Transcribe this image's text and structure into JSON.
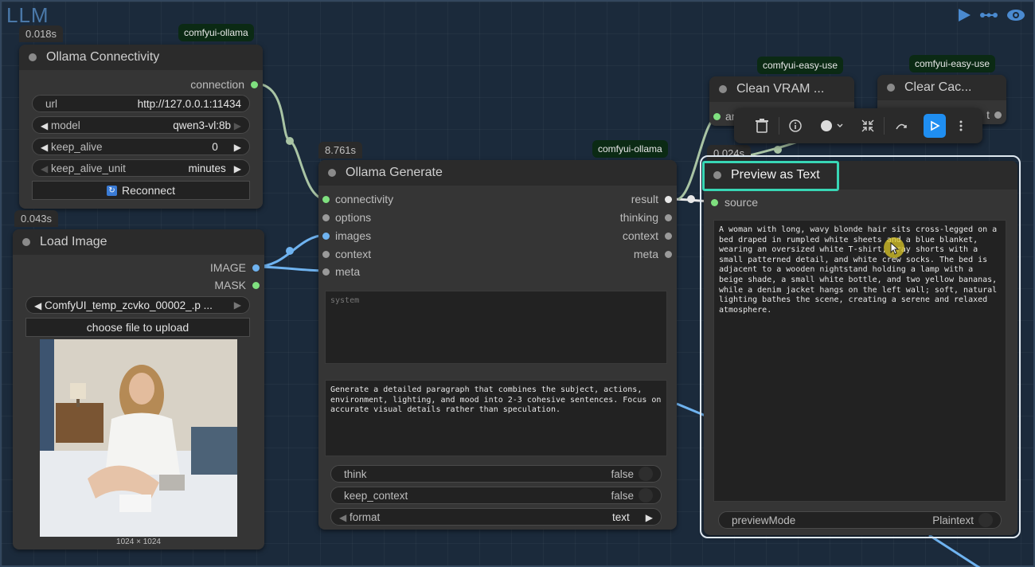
{
  "group": {
    "title": "LLM"
  },
  "nodes": {
    "connectivity": {
      "timing": "0.018s",
      "pack": "comfyui-ollama",
      "title": "Ollama Connectivity",
      "output": "connection",
      "url_label": "url",
      "url_value": "http://127.0.0.1:11434",
      "model_label": "model",
      "model_value": "qwen3-vl:8b",
      "keep_alive_label": "keep_alive",
      "keep_alive_value": "0",
      "keep_alive_unit_label": "keep_alive_unit",
      "keep_alive_unit_value": "minutes",
      "reconnect": "Reconnect"
    },
    "load_image": {
      "timing": "0.043s",
      "title": "Load Image",
      "out_image": "IMAGE",
      "out_mask": "MASK",
      "filename": "ComfyUI_temp_zcvko_00002_.p ...",
      "upload": "choose file to upload",
      "dims": "1024 × 1024"
    },
    "generate": {
      "timing": "8.761s",
      "pack": "comfyui-ollama",
      "title": "Ollama Generate",
      "inputs": [
        "connectivity",
        "options",
        "images",
        "context",
        "meta"
      ],
      "outputs": [
        "result",
        "thinking",
        "context",
        "meta"
      ],
      "system_placeholder": "system",
      "prompt": "Generate a detailed paragraph that combines the subject, actions, environment, lighting, and mood into 2-3 cohesive sentences. Focus on accurate visual details rather than speculation.",
      "think_label": "think",
      "think_value": "false",
      "keep_context_label": "keep_context",
      "keep_context_value": "false",
      "format_label": "format",
      "format_value": "text"
    },
    "clean_vram": {
      "pack": "comfyui-easy-use",
      "title": "Clean VRAM ...",
      "input_fragment": "an"
    },
    "clear_cache": {
      "pack": "comfyui-easy-use",
      "title": "Clear Cac...",
      "output_fragment": "t"
    },
    "preview": {
      "timing": "0.024s",
      "title": "Preview as Text",
      "input": "source",
      "text": "A woman with long, wavy blonde hair sits cross-legged on a bed draped in rumpled white sheets and a blue blanket, wearing an oversized white T-shirt, gray shorts with a small patterned detail, and white crew socks. The bed is adjacent to a wooden nightstand holding a lamp with a beige shade, a small white bottle, and two yellow bananas, while a denim jacket hangs on the left wall; soft, natural lighting bathes the scene, creating a serene and relaxed atmosphere.",
      "preview_mode_label": "previewMode",
      "preview_mode_value": "Plaintext"
    }
  },
  "colors": {
    "accent_highlight": "#38d6b5",
    "active_button": "#1f8ef1",
    "wire_blue": "#6fb3f0",
    "wire_green": "#a9c4a4"
  }
}
